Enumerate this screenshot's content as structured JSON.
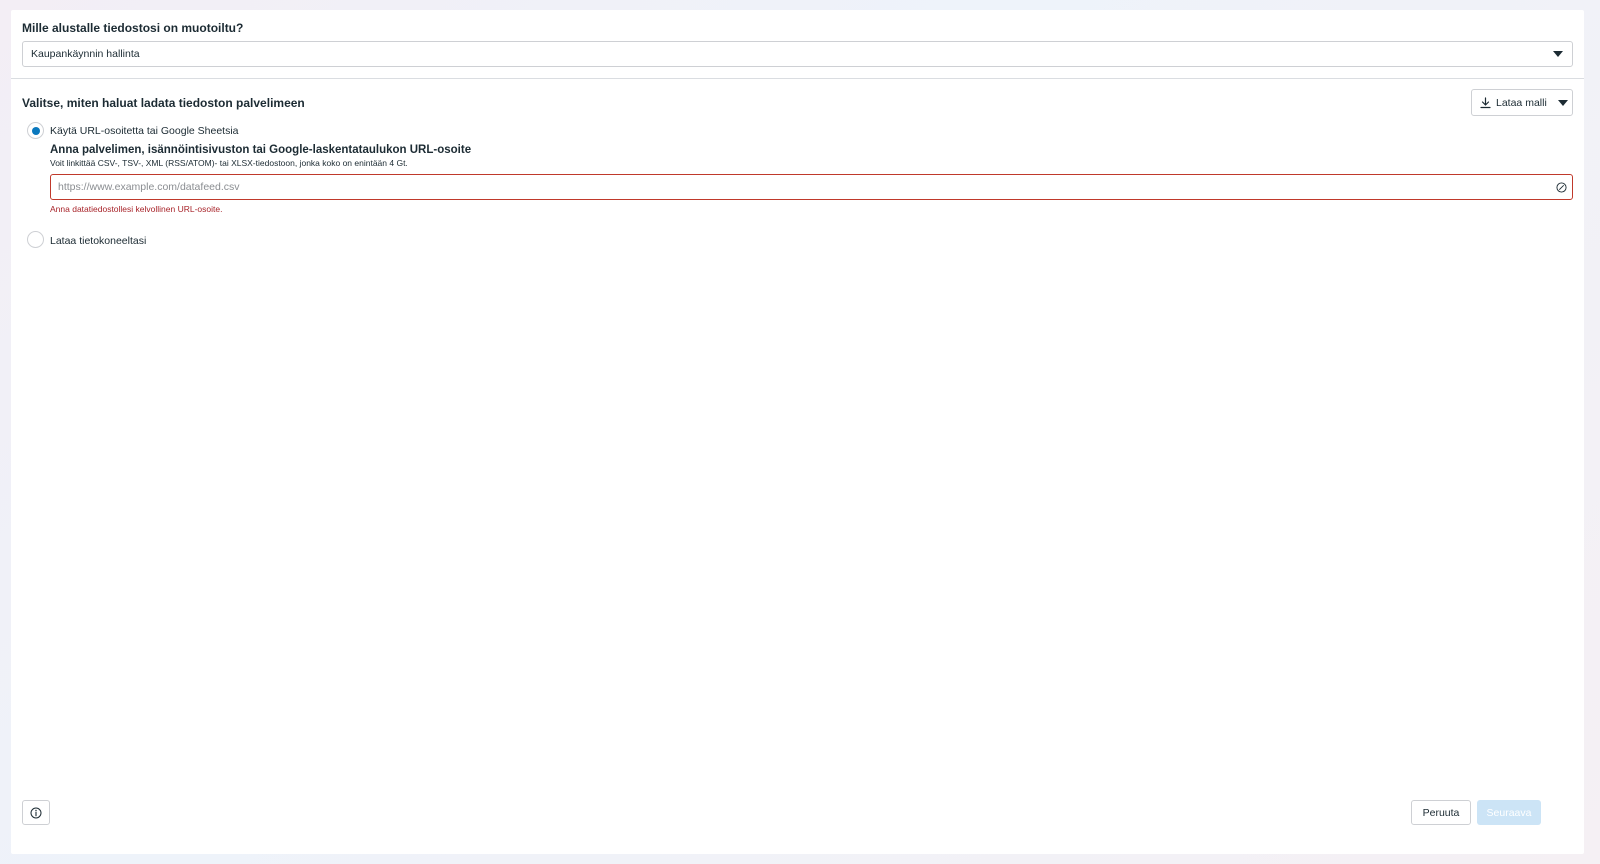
{
  "format_question": {
    "title": "Mille alustalle tiedostosi on muotoiltu?",
    "selected_value": "Kaupankäynnin hallinta"
  },
  "upload": {
    "title": "Valitse, miten haluat ladata tiedoston palvelimeen",
    "template_button_label": "Lataa malli",
    "options": [
      {
        "label": "Käytä URL-osoitetta tai Google Sheetsia",
        "selected": true
      },
      {
        "label": "Lataa tietokoneeltasi",
        "selected": false
      }
    ],
    "url_field": {
      "title": "Anna palvelimen, isännöintisivuston tai Google-laskentataulukon URL-osoite",
      "description": "Voit linkittää CSV-, TSV-, XML (RSS/ATOM)- tai XLSX-tiedostoon, jonka koko on enintään 4 Gt.",
      "placeholder": "https://www.example.com/datafeed.csv",
      "value": "",
      "error": "Anna datatiedostollesi kelvollinen URL-osoite."
    }
  },
  "footer": {
    "cancel_label": "Peruuta",
    "next_label": "Seuraava"
  },
  "colors": {
    "accent": "#0a78be",
    "error": "#a8242a",
    "disabled_primary": "#cce4f6"
  },
  "icons": {
    "select_caret": "chevron-down-icon",
    "template": "download-icon",
    "url_error": "error-icon",
    "info": "info-icon"
  }
}
